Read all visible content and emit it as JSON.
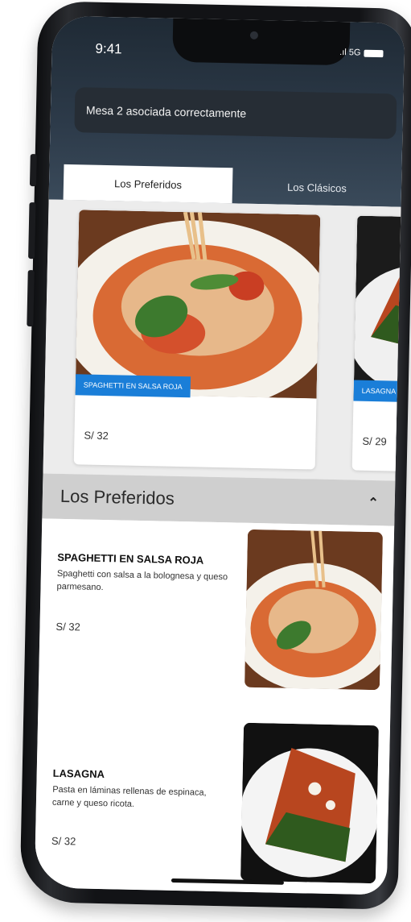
{
  "status": {
    "time": "9:41",
    "network": ".ıl 5G"
  },
  "toast": {
    "message": "Mesa 2 asociada correctamente"
  },
  "tabs": [
    {
      "label": "Los Preferidos",
      "active": true
    },
    {
      "label": "Los Clásicos",
      "active": false
    }
  ],
  "carousel": [
    {
      "label": "SPAGHETTI EN SALSA ROJA",
      "price": "S/ 32"
    },
    {
      "label": "LASAGNA",
      "price": "S/ 29"
    }
  ],
  "section": {
    "title": "Los Preferidos"
  },
  "list": [
    {
      "name": "SPAGHETTI  EN SALSA ROJA",
      "description": "Spaghetti con salsa a la bolognesa y queso parmesano.",
      "price": "S/ 32"
    },
    {
      "name": "LASAGNA",
      "description": "Pasta en láminas rellenas de espinaca, carne y queso ricota.",
      "price": "S/ 32"
    }
  ],
  "colors": {
    "accent": "#1a7ed8",
    "header": "#2d3b4a",
    "section": "#cfcfcf"
  }
}
